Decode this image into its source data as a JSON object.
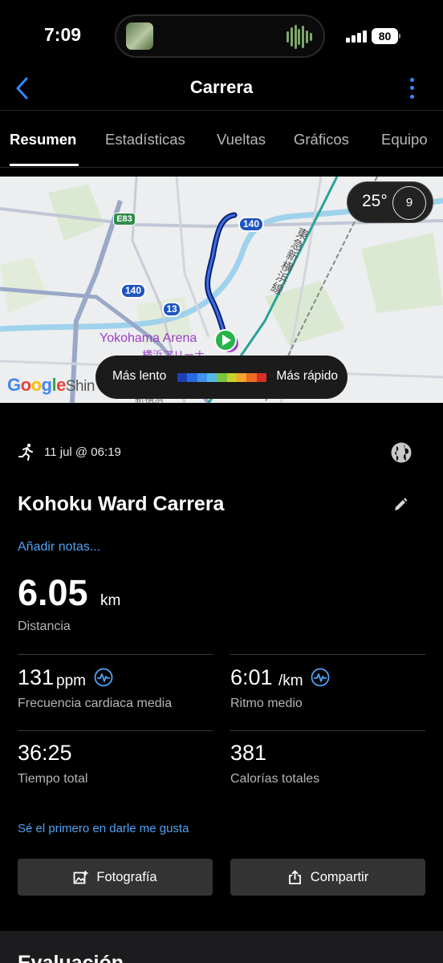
{
  "status_bar": {
    "time": "7:09",
    "battery": "80"
  },
  "header": {
    "title": "Carrera",
    "back_icon": "chevron-left-icon",
    "more_icon": "vertical-ellipsis-icon",
    "accent_color": "#2f8cff"
  },
  "tabs": [
    {
      "label": "Resumen",
      "active": true
    },
    {
      "label": "Estadísticas",
      "active": false
    },
    {
      "label": "Vueltas",
      "active": false
    },
    {
      "label": "Gráficos",
      "active": false
    },
    {
      "label": "Equipo",
      "active": false
    }
  ],
  "map": {
    "weather_temp": "25°",
    "wind_speed": "9",
    "labels": {
      "road_e83": "E83",
      "road_140_a": "140",
      "road_140_b": "140",
      "road_13": "13",
      "arena": "Yokohama Arena",
      "arena_jp": "横浜アリーナ",
      "station_jp": "新横浜",
      "line_jp": "東急新横浜線",
      "shin": "Shin",
      "google_g": "G",
      "google_o1": "o",
      "google_o2": "o",
      "google_g2": "g",
      "google_l": "l",
      "google_e": "e"
    },
    "pace_legend": {
      "slow": "Más lento",
      "fast": "Más rápido",
      "colors": [
        "#1e3fb5",
        "#2a6ae0",
        "#3f93ea",
        "#56b7e8",
        "#7bc441",
        "#c9cf2e",
        "#f2a52a",
        "#ee6a24",
        "#d9302a"
      ]
    }
  },
  "activity": {
    "type_icon": "running-person-icon",
    "date": "11 jul @ 06:19",
    "privacy_icon": "globe-icon",
    "title": "Kohoku Ward Carrera",
    "edit_icon": "pencil-icon",
    "add_notes": "Añadir notas...",
    "distance": {
      "value": "6.05",
      "unit": "km",
      "label": "Distancia"
    },
    "stats": {
      "heart_rate": {
        "value": "131",
        "unit": "ppm",
        "label": "Frecuencia cardiaca media",
        "icon": "heart-rate-icon"
      },
      "pace": {
        "value": "6:01",
        "unit": "/km",
        "label": "Ritmo medio",
        "icon": "heart-rate-icon"
      },
      "total_time": {
        "value": "36:25",
        "label": "Tiempo total"
      },
      "calories": {
        "value": "381",
        "label": "Calorías totales"
      }
    },
    "likes_text": "Sé el primero en darle me gusta",
    "buttons": {
      "photo": "Fotografía",
      "share": "Compartir"
    }
  },
  "next_section": {
    "title": "Evaluación"
  }
}
